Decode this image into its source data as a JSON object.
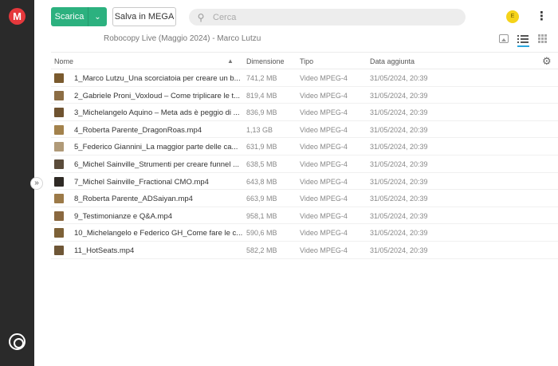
{
  "app": {
    "logo": "M",
    "logo_color": "#e5383c"
  },
  "toolbar": {
    "download_label": "Scarica",
    "save_label": "Salva in MEGA",
    "search_placeholder": "Cerca",
    "avatar_initial": "E",
    "accent": "#2cb17f"
  },
  "breadcrumb": "Robocopy Live (Maggio 2024) - Marco Lutzu",
  "columns": {
    "name": "Nome",
    "size": "Dimensione",
    "type": "Tipo",
    "date": "Data aggiunta"
  },
  "files": [
    {
      "name": "1_Marco Lutzu_Una scorciatoia per creare un b...",
      "size": "741,2 MB",
      "type": "Video MPEG-4",
      "date": "31/05/2024, 20:39",
      "thumb": "#7a5a2e"
    },
    {
      "name": "2_Gabriele Proni_Voxloud – Come triplicare le t...",
      "size": "819,4 MB",
      "type": "Video MPEG-4",
      "date": "31/05/2024, 20:39",
      "thumb": "#8c6d44"
    },
    {
      "name": "3_Michelangelo Aquino – Meta ads è peggio di ...",
      "size": "836,9 MB",
      "type": "Video MPEG-4",
      "date": "31/05/2024, 20:39",
      "thumb": "#6f5330"
    },
    {
      "name": "4_Roberta Parente_DragonRoas.mp4",
      "size": "1,13 GB",
      "type": "Video MPEG-4",
      "date": "31/05/2024, 20:39",
      "thumb": "#a3824c"
    },
    {
      "name": "5_Federico Giannini_La maggior parte delle ca...",
      "size": "631,9 MB",
      "type": "Video MPEG-4",
      "date": "31/05/2024, 20:39",
      "thumb": "#b09a78"
    },
    {
      "name": "6_Michel Sainville_Strumenti per creare funnel ...",
      "size": "638,5 MB",
      "type": "Video MPEG-4",
      "date": "31/05/2024, 20:39",
      "thumb": "#5a4b3a"
    },
    {
      "name": "7_Michel Sainville_Fractional CMO.mp4",
      "size": "643,8 MB",
      "type": "Video MPEG-4",
      "date": "31/05/2024, 20:39",
      "thumb": "#2f2a25"
    },
    {
      "name": "8_Roberta Parente_ADSaiyan.mp4",
      "size": "663,9 MB",
      "type": "Video MPEG-4",
      "date": "31/05/2024, 20:39",
      "thumb": "#9c7a48"
    },
    {
      "name": "9_Testimonianze e Q&A.mp4",
      "size": "958,1 MB",
      "type": "Video MPEG-4",
      "date": "31/05/2024, 20:39",
      "thumb": "#8a6840"
    },
    {
      "name": "10_Michelangelo e Federico GH_Come fare le c...",
      "size": "590,6 MB",
      "type": "Video MPEG-4",
      "date": "31/05/2024, 20:39",
      "thumb": "#7d6137"
    },
    {
      "name": "11_HotSeats.mp4",
      "size": "582,2 MB",
      "type": "Video MPEG-4",
      "date": "31/05/2024, 20:39",
      "thumb": "#6e5636"
    }
  ]
}
